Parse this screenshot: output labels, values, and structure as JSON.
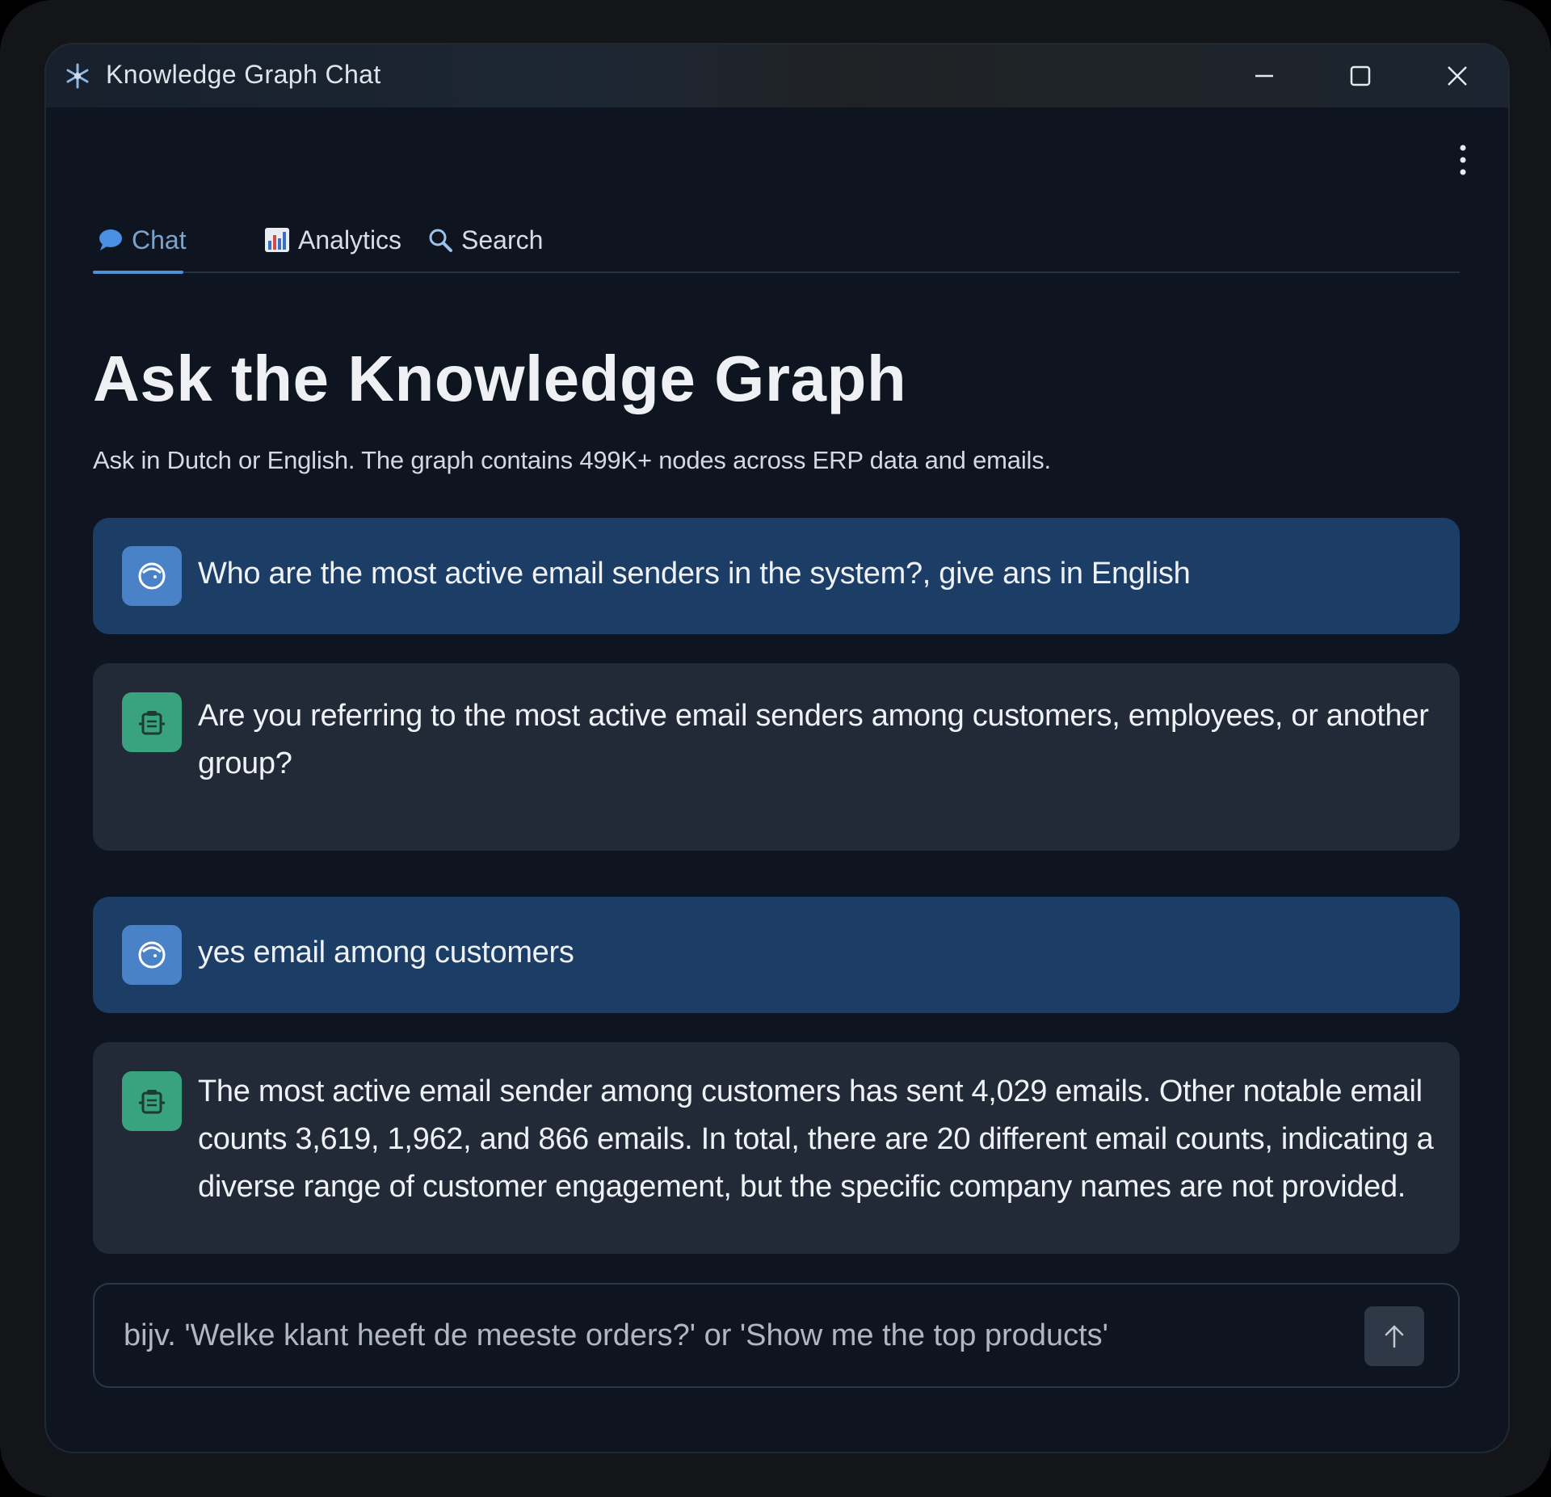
{
  "window": {
    "title": "Knowledge Graph Chat",
    "icon": "snowflake-icon"
  },
  "tabs": [
    {
      "label": "Chat",
      "icon": "speech-bubble-icon",
      "active": true
    },
    {
      "label": "Analytics",
      "icon": "bar-chart-icon",
      "active": false
    },
    {
      "label": "Search",
      "icon": "magnifier-icon",
      "active": false
    }
  ],
  "header": {
    "title": "Ask the Knowledge Graph",
    "subtitle": "Ask in Dutch or English. The graph contains 499K+ nodes across ERP data and emails."
  },
  "messages": [
    {
      "role": "user",
      "avatar_icon": "user-avatar-icon",
      "text": "Who are the most active email senders in the system?, give ans in English"
    },
    {
      "role": "assistant",
      "avatar_icon": "robot-avatar-icon",
      "text": "Are you referring to the most active email senders among customers, employees, or another group?"
    },
    {
      "role": "user",
      "avatar_icon": "user-avatar-icon",
      "text": "yes email among customers"
    },
    {
      "role": "assistant",
      "avatar_icon": "robot-avatar-icon",
      "text": "The most active email sender among customers has sent 4,029 emails. Other notable email counts 3,619, 1,962, and 866 emails. In total, there are 20 different email counts, indicating a diverse range of customer engagement, but the specific company names are not provided."
    }
  ],
  "input": {
    "placeholder": "bijv. 'Welke klant heeft de meeste orders?' or 'Show me the top products'",
    "value": ""
  },
  "colors": {
    "accent": "#4f8fd6",
    "user_bubble": "#1b3d66",
    "assistant_bubble": "#232a37",
    "user_avatar": "#4a82c8",
    "assistant_avatar": "#39a27e",
    "background": "#0f1520"
  }
}
